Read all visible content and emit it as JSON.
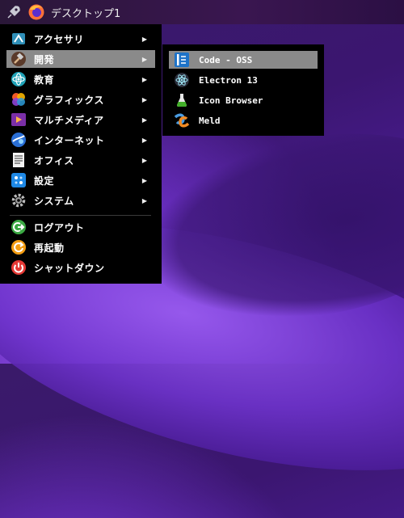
{
  "taskbar": {
    "title": "デスクトップ1",
    "icons": [
      "rocket-icon",
      "firefox-icon"
    ]
  },
  "menu": {
    "items": [
      {
        "label": "アクセサリ",
        "icon": "accessories-icon",
        "submenu": true
      },
      {
        "label": "開発",
        "icon": "development-hammer-icon",
        "submenu": true,
        "selected": true
      },
      {
        "label": "教育",
        "icon": "education-atom-icon",
        "submenu": true
      },
      {
        "label": "グラフィックス",
        "icon": "graphics-icon",
        "submenu": true
      },
      {
        "label": "マルチメディア",
        "icon": "multimedia-icon",
        "submenu": true
      },
      {
        "label": "インターネット",
        "icon": "internet-globe-icon",
        "submenu": true
      },
      {
        "label": "オフィス",
        "icon": "office-document-icon",
        "submenu": true
      },
      {
        "label": "設定",
        "icon": "settings-icon",
        "submenu": true
      },
      {
        "label": "システム",
        "icon": "system-gear-icon",
        "submenu": true
      },
      {
        "label": "ログアウト",
        "icon": "logout-icon",
        "submenu": false
      },
      {
        "label": "再起動",
        "icon": "restart-icon",
        "submenu": false
      },
      {
        "label": "シャットダウン",
        "icon": "shutdown-icon",
        "submenu": false
      }
    ],
    "arrow": "▶"
  },
  "submenu": {
    "items": [
      {
        "label": "Code - OSS",
        "icon": "code-oss-icon",
        "selected": true
      },
      {
        "label": "Electron 13",
        "icon": "electron-icon"
      },
      {
        "label": "Icon Browser",
        "icon": "flask-icon"
      },
      {
        "label": "Meld",
        "icon": "meld-icon"
      }
    ]
  },
  "colors": {
    "menu_bg": "#000000",
    "selection": "#8a8a8a",
    "text": "#ffffff"
  }
}
